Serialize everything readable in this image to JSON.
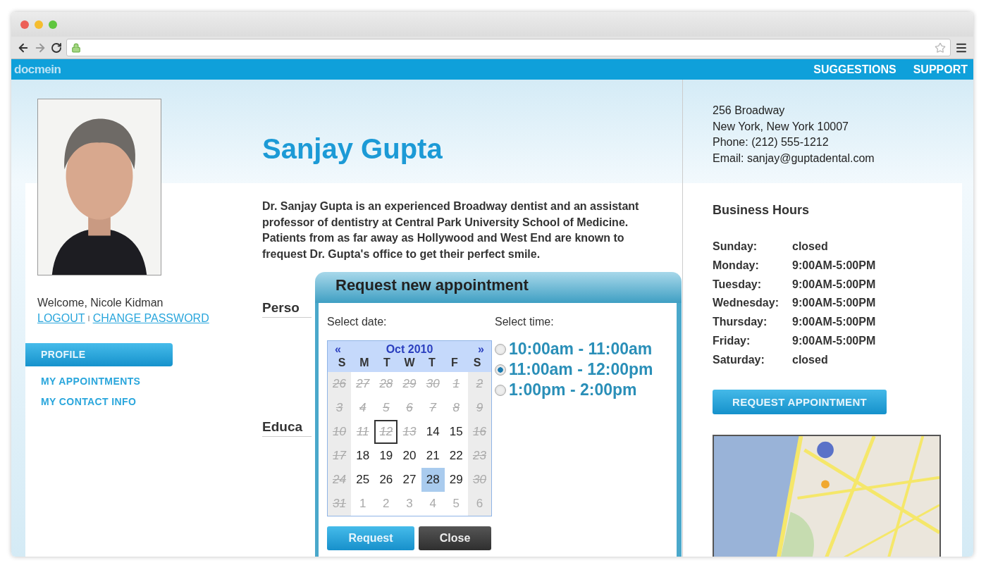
{
  "nav": {
    "logo": "docmein",
    "links": [
      "SUGGESTIONS",
      "SUPPORT"
    ]
  },
  "user": {
    "welcome": "Welcome, Nicole Kidman",
    "logout": "LOGOUT",
    "separator": "I",
    "change_password": "CHANGE PASSWORD"
  },
  "sidebar": {
    "items": [
      {
        "label": "PROFILE",
        "selected": true
      },
      {
        "label": "MY APPOINTMENTS",
        "selected": false
      },
      {
        "label": "MY CONTACT INFO",
        "selected": false
      }
    ]
  },
  "doctor": {
    "name": "Sanjay Gupta",
    "bio": "Dr. Sanjay Gupta is an experienced Broadway dentist and an assistant professor of dentistry at Central Park University School of Medicine. Patients from as far away as Hollywood and West End are known to frequest Dr. Gupta's office to get their perfect smile.",
    "sections": [
      "Perso",
      "Educa"
    ]
  },
  "address": [
    "256 Broadway",
    "New York, New York 10007",
    "Phone: (212) 555-1212",
    "Email: sanjay@guptadental.com"
  ],
  "hours": {
    "title": "Business Hours",
    "rows": [
      {
        "day": "Sunday:",
        "time": "closed"
      },
      {
        "day": "Monday:",
        "time": "9:00AM-5:00PM"
      },
      {
        "day": "Tuesday:",
        "time": "9:00AM-5:00PM"
      },
      {
        "day": "Wednesday:",
        "time": "9:00AM-5:00PM"
      },
      {
        "day": "Thursday:",
        "time": "9:00AM-5:00PM"
      },
      {
        "day": "Friday:",
        "time": "9:00AM-5:00PM"
      },
      {
        "day": "Saturday:",
        "time": "closed"
      }
    ],
    "button": "REQUEST APPOINTMENT"
  },
  "modal": {
    "title": "Request new appointment",
    "date_label": "Select date:",
    "time_label": "Select time:",
    "calendar": {
      "prev": "«",
      "month": "Oct 2010",
      "next": "»",
      "weekdays": [
        "S",
        "M",
        "T",
        "W",
        "T",
        "F",
        "S"
      ],
      "days": [
        {
          "d": "26",
          "kind": "past",
          "selected": false,
          "today": false
        },
        {
          "d": "27",
          "kind": "past",
          "selected": false,
          "today": false
        },
        {
          "d": "28",
          "kind": "past",
          "selected": false,
          "today": false
        },
        {
          "d": "29",
          "kind": "past",
          "selected": false,
          "today": false
        },
        {
          "d": "30",
          "kind": "past",
          "selected": false,
          "today": false
        },
        {
          "d": "1",
          "kind": "past",
          "selected": false,
          "today": false
        },
        {
          "d": "2",
          "kind": "past",
          "selected": false,
          "today": false
        },
        {
          "d": "3",
          "kind": "past",
          "selected": false,
          "today": false
        },
        {
          "d": "4",
          "kind": "past",
          "selected": false,
          "today": false
        },
        {
          "d": "5",
          "kind": "past",
          "selected": false,
          "today": false
        },
        {
          "d": "6",
          "kind": "past",
          "selected": false,
          "today": false
        },
        {
          "d": "7",
          "kind": "past",
          "selected": false,
          "today": false
        },
        {
          "d": "8",
          "kind": "past",
          "selected": false,
          "today": false
        },
        {
          "d": "9",
          "kind": "past",
          "selected": false,
          "today": false
        },
        {
          "d": "10",
          "kind": "past",
          "selected": false,
          "today": false
        },
        {
          "d": "11",
          "kind": "past",
          "selected": false,
          "today": false
        },
        {
          "d": "12",
          "kind": "past",
          "selected": false,
          "today": true
        },
        {
          "d": "13",
          "kind": "past",
          "selected": false,
          "today": false
        },
        {
          "d": "14",
          "kind": "open",
          "selected": false,
          "today": false
        },
        {
          "d": "15",
          "kind": "open",
          "selected": false,
          "today": false
        },
        {
          "d": "16",
          "kind": "past",
          "selected": false,
          "today": false
        },
        {
          "d": "17",
          "kind": "past",
          "selected": false,
          "today": false
        },
        {
          "d": "18",
          "kind": "open",
          "selected": false,
          "today": false
        },
        {
          "d": "19",
          "kind": "open",
          "selected": false,
          "today": false
        },
        {
          "d": "20",
          "kind": "open",
          "selected": false,
          "today": false
        },
        {
          "d": "21",
          "kind": "open",
          "selected": false,
          "today": false
        },
        {
          "d": "22",
          "kind": "open",
          "selected": false,
          "today": false
        },
        {
          "d": "23",
          "kind": "past",
          "selected": false,
          "today": false
        },
        {
          "d": "24",
          "kind": "past",
          "selected": false,
          "today": false
        },
        {
          "d": "25",
          "kind": "open",
          "selected": false,
          "today": false
        },
        {
          "d": "26",
          "kind": "open",
          "selected": false,
          "today": false
        },
        {
          "d": "27",
          "kind": "open",
          "selected": false,
          "today": false
        },
        {
          "d": "28",
          "kind": "open",
          "selected": true,
          "today": false
        },
        {
          "d": "29",
          "kind": "open",
          "selected": false,
          "today": false
        },
        {
          "d": "30",
          "kind": "past",
          "selected": false,
          "today": false
        },
        {
          "d": "31",
          "kind": "past",
          "selected": false,
          "today": false
        },
        {
          "d": "1",
          "kind": "next",
          "selected": false,
          "today": false
        },
        {
          "d": "2",
          "kind": "next",
          "selected": false,
          "today": false
        },
        {
          "d": "3",
          "kind": "next",
          "selected": false,
          "today": false
        },
        {
          "d": "4",
          "kind": "next",
          "selected": false,
          "today": false
        },
        {
          "d": "5",
          "kind": "next",
          "selected": false,
          "today": false
        },
        {
          "d": "6",
          "kind": "next",
          "selected": false,
          "today": false
        }
      ]
    },
    "times": [
      {
        "label": "10:00am - 11:00am",
        "selected": false
      },
      {
        "label": "11:00am - 12:00pm",
        "selected": true
      },
      {
        "label": "1:00pm - 2:00pm",
        "selected": false
      }
    ],
    "buttons": [
      {
        "label": "Request",
        "kind": "primary"
      },
      {
        "label": "Close",
        "kind": "dark"
      }
    ]
  }
}
